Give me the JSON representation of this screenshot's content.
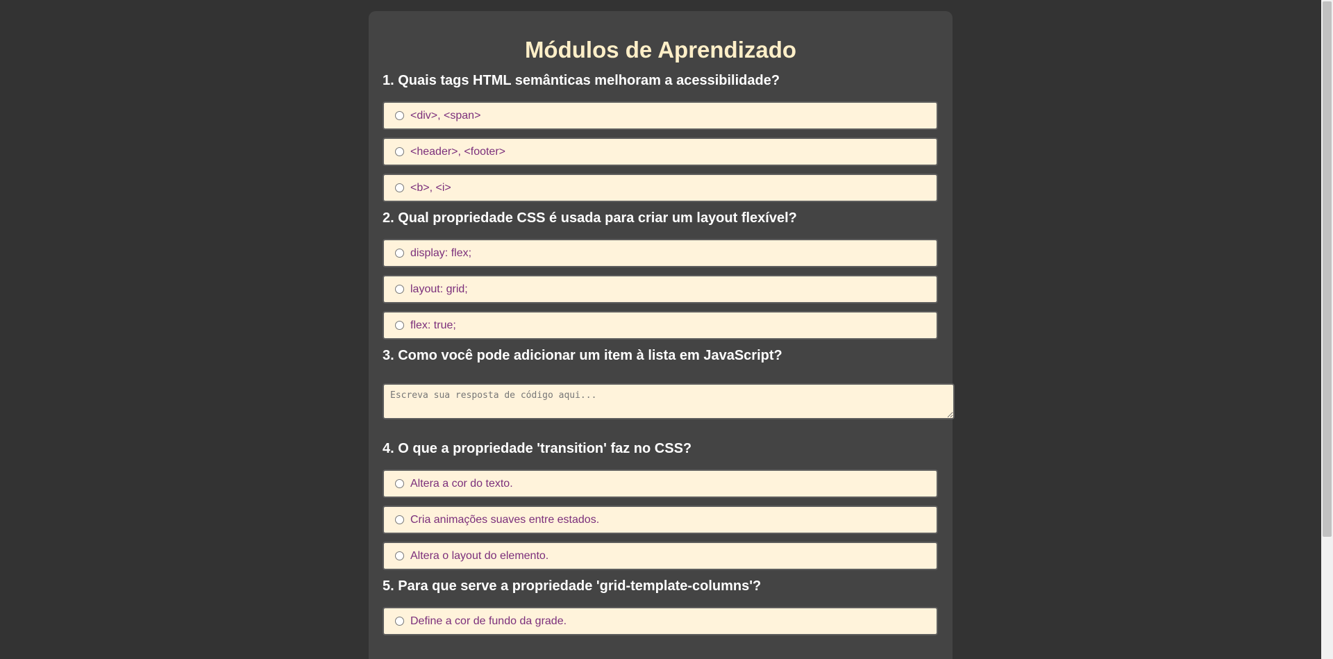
{
  "page": {
    "title": "Módulos de Aprendizado"
  },
  "questions": [
    {
      "text": "1. Quais tags HTML semânticas melhoram a acessibilidade?",
      "options": [
        "<div>, <span>",
        "<header>, <footer>",
        "<b>, <i>"
      ]
    },
    {
      "text": "2. Qual propriedade CSS é usada para criar um layout flexível?",
      "options": [
        "display: flex;",
        "layout: grid;",
        "flex: true;"
      ]
    },
    {
      "text": "3. Como você pode adicionar um item à lista em JavaScript?",
      "placeholder": "Escreva sua resposta de código aqui..."
    },
    {
      "text": "4. O que a propriedade 'transition' faz no CSS?",
      "options": [
        "Altera a cor do texto.",
        "Cria animações suaves entre estados.",
        "Altera o layout do elemento."
      ]
    },
    {
      "text": "5. Para que serve a propriedade 'grid-template-columns'?",
      "options": [
        "Define a cor de fundo da grade."
      ]
    }
  ],
  "colors": {
    "background": "#333333",
    "panel": "#444444",
    "title": "#ffefc8",
    "option_background": "#fff3db",
    "option_text": "#7b2f7b"
  }
}
